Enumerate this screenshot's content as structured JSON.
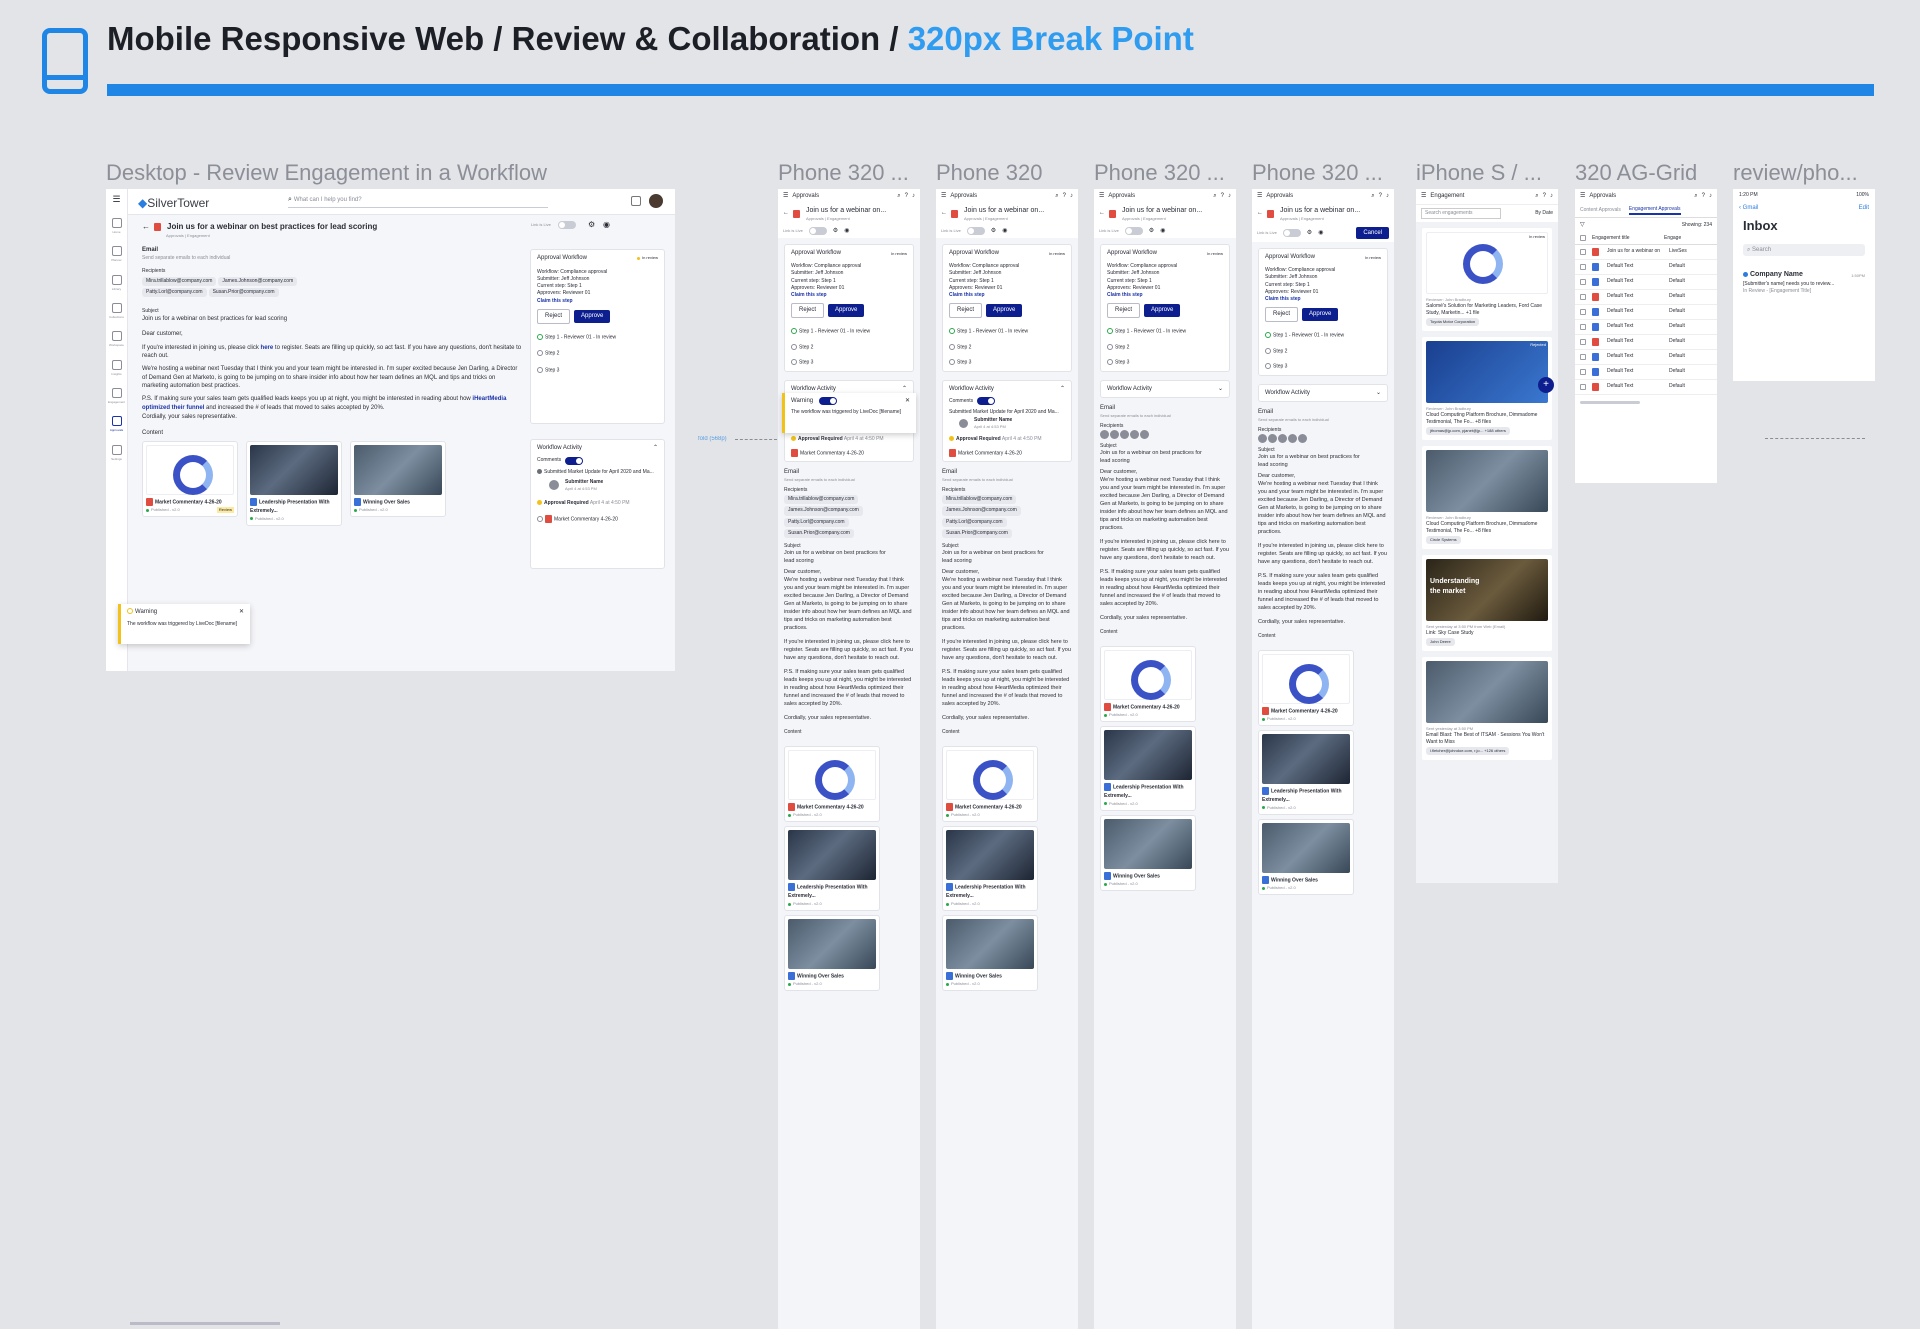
{
  "header": {
    "title_main": "Mobile Responsive Web / Review & Collaboration / ",
    "title_accent": "320px Break Point"
  },
  "frame_labels": [
    "Desktop - Review Engagement in a Workflow",
    "Phone 320 ...",
    "Phone 320",
    "Phone 320 ...",
    "Phone 320 ...",
    "iPhone S / ...",
    "320 AG-Grid",
    "review/pho..."
  ],
  "desktop": {
    "logo": "SilverTower",
    "search_placeholder": "What can I help you find?",
    "sidebar": [
      "Home",
      "Planner",
      "Library",
      "Collections",
      "Workspace",
      "Insights",
      "Engagement",
      "Approvals",
      "Settings"
    ],
    "page_title": "Join us for a webinar on best practices for lead scoring",
    "breadcrumb": "Approvals | Engagement",
    "link_is_live": "Link is Live",
    "email_label": "Email",
    "send_note": "Send separate emails to each individual",
    "recipients_label": "Recipients",
    "recipients": [
      "Mira.trillablow@company.com",
      "James.Johnson@company.com",
      "Patty.Lorl@company.com",
      "Susan.Prior@company.com"
    ],
    "subject_label": "Subject",
    "subject": "Join us for a webinar on best practices for lead scoring",
    "greeting": "Dear customer,",
    "p1a": "If you're interested in joining us, please click ",
    "p1link": "here",
    "p1b": " to register. Seats are filling up quickly, so act fast. If you have any questions, don't hesitate to reach out.",
    "p2": "We're hosting a webinar next Tuesday that I think you and your team might be interested in. I'm super excited because Jen Darling, a Director of Demand Gen at Marketo, is going to be jumping on to share insider info about how her team defines an MQL and tips and tricks on marketing automation best practices.",
    "p3a": "P.S. If making sure your sales team gets qualified leads keeps you up at night, you might be interested in reading about how ",
    "p3link": "iHeartMedia optimized their funnel",
    "p3b": " and increased the # of leads that moved to sales accepted by 20%.",
    "closing": "Cordially, your sales representative.",
    "content_label": "Content",
    "content": [
      {
        "title": "Market Commentary 4-26-20",
        "status": "Published - v2.0",
        "badge": "Review"
      },
      {
        "title": "Leadership Presentation With Extremely...",
        "status": "Published - v2.0"
      },
      {
        "title": "Winning Over Sales",
        "status": "Published - v2.0"
      }
    ],
    "workflow": {
      "title": "Approval Workflow",
      "state": "In review",
      "workflow": "Workflow: Compliance approval",
      "submitter": "Submitter: Jeff Johnson",
      "current_step": "Current step: Step 1",
      "approvers": "Approvers: Reviewer 01",
      "claim": "Claim this step",
      "reject": "Reject",
      "approve": "Approve",
      "steps": [
        "Step 1 - Reviewer 01 - In review",
        "Step 2",
        "Step 3"
      ]
    },
    "activity": {
      "title": "Workflow Activity",
      "comments": "Comments",
      "submitted": "Submitted Market Update for April 2020 and Ma...",
      "submitter_name": "Submitter Name",
      "submitter_time": "April 4 at 4:53 PM",
      "approval_required": "Approval Required",
      "approval_time": "April 4 at 4:50 PM",
      "item": "Market Commentary 4-26-20"
    },
    "warning": {
      "title": "Warning",
      "text": "The workflow was triggered by LiveDoc [filename]"
    }
  },
  "phone": {
    "tab": "Approvals",
    "title": "Join us for a webinar on...",
    "crumb": "Approvals | Engagement",
    "live": "Link is Live",
    "cancel": "Cancel",
    "wf_title": "Approval Workflow",
    "state": "In review",
    "wf": "Workflow: Compliance approval",
    "sub": "Submitter: Jeff Johnson",
    "step": "Current step: Step 1",
    "appr": "Approvers: Reviewer 01",
    "claim": "Claim this step",
    "reject": "Reject",
    "approve": "Approve",
    "steps": [
      "Step 1 - Reviewer 01 - In review",
      "Step 2",
      "Step 3"
    ],
    "activity": "Workflow Activity",
    "comments": "Comments",
    "submitted": "Submitted Market Update for April 2020 and Ma...",
    "sname": "Submitter Name",
    "stime": "April 4 at 4:53 PM",
    "areq": "Approval Required",
    "atime": "April 4 at 4:50 PM",
    "mc": "Market Commentary 4-26-20",
    "email": "Email",
    "send": "Send separate emails to each individual",
    "recip": "Recipients",
    "subj_l": "Subject",
    "subject": "Join us for a webinar on best practices for lead scoring",
    "dear": "Dear customer,",
    "b1": "We're hosting a webinar next Tuesday that I think you and your team might be interested in. I'm super excited because Jen Darling, a Director of Demand Gen at Marketo, is going to be jumping on to share insider info about how her team defines an MQL and tips and tricks on marketing automation best practices.",
    "b2": "If you're interested in joining us, please click here to register. Seats are filling up quickly, so act fast. If you have any questions, don't hesitate to reach out.",
    "b3": "P.S. If making sure your sales team gets qualified leads keeps you up at night, you might be interested in reading about how iHeartMedia optimized their funnel and increased the # of leads that moved to sales accepted by 20%.",
    "close": "Cordially, your sales representative.",
    "content": "Content",
    "c1": "Market Commentary 4-26-20",
    "c2": "Leadership Presentation With Extremely...",
    "c3": "Winning Over Sales",
    "pub": "Published - v2.0",
    "warn_t": "Warning",
    "warn_x": "The workflow was triggered by LiveDoc [filename]"
  },
  "iphone_s": {
    "tab": "Engagement",
    "search": "Search engagements",
    "sort": "By Date",
    "state": "In review",
    "rejected": "Rejected",
    "cards": [
      {
        "reviewer": "Reviewer: John Bradbury",
        "title": "Salomé's Solution for Marketing Leaders, Ford Case Study, Marketin... +1 file",
        "tag": "Toyota Motor Corporation"
      },
      {
        "reviewer": "Reviewer: John Bradbury",
        "title": "Cloud Computing Platform Brochure, Dimmadome Testimonial, The Fo... +8 files",
        "tag": "jthomas@jp.com, pjanet@jp... +188 others"
      },
      {
        "reviewer": "Reviewer: John Bradbury",
        "title": "Cloud Computing Platform Brochure, Dimmadome Testimonial, The Fo... +8 files",
        "tag": "Circle Systems"
      },
      {
        "reviewer": "Sent yesterday at 3:50 PM from Web (Email)",
        "title": "Link: Sky Case Study",
        "tag": "John Deere",
        "thumb_text": "Understanding the market"
      },
      {
        "reviewer": "Sent yesterday at 3:50 PM",
        "title": "Email Blast: The Best of ITSAM · Sessions You Won't Want to Miss",
        "tag": "l.fletcher@johndoe.com, r.jo... +126 others"
      }
    ]
  },
  "aggrid": {
    "tab": "Approvals",
    "tab1": "Content Approvals",
    "tab2": "Engagement Approvals",
    "showing": "Showing: 234",
    "col1": "Engagement title",
    "col2": "Engage",
    "rows": [
      "Join us for a webinar on",
      "Default Text",
      "Default Text",
      "Default Text",
      "Default Text",
      "Default Text",
      "Default Text",
      "Default Text",
      "Default Text",
      "Default Text"
    ],
    "col2vals": [
      "LiveSes",
      "Default",
      "Default",
      "Default",
      "Default",
      "Default",
      "Default",
      "Default",
      "Default",
      "Default"
    ]
  },
  "review_phone": {
    "time": "1:20 PM",
    "battery": "100%",
    "back": "Gmail",
    "edit": "Edit",
    "title": "Inbox",
    "search": "Search",
    "sender": "Company Name",
    "msg_time": "1:50PM",
    "msg": "[Submitter's name] needs you to review...",
    "msg2": "In Review - [Engagement Title]"
  },
  "annotation": "fold (568p)",
  "colors": {
    "accent": "#1f86e6",
    "primary": "#0d1f8f",
    "warning": "#f2c21a"
  }
}
